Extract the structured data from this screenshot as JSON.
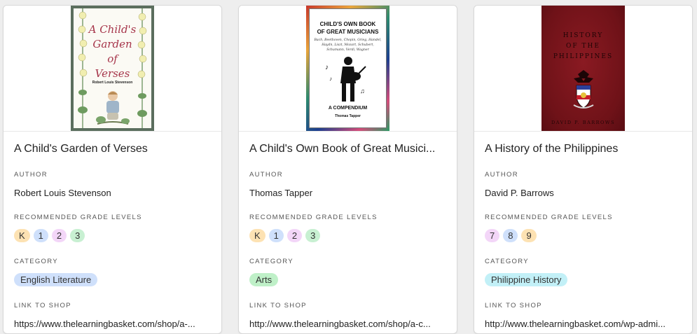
{
  "labels": {
    "author": "AUTHOR",
    "grades": "RECOMMENDED GRADE LEVELS",
    "category": "CATEGORY",
    "link": "LINK TO SHOP"
  },
  "colors": {
    "grade_K": "#fde2b3",
    "grade_1": "#cfe0fb",
    "grade_2": "#f3d6f8",
    "grade_3": "#c8f0d2",
    "grade_7": "#f3d6f8",
    "grade_8": "#cfe0fb",
    "grade_9": "#fde2b3",
    "cat_english": "#cfe0fb",
    "cat_arts": "#bff0c8",
    "cat_history": "#c2f0f7"
  },
  "books": [
    {
      "title": "A Child's Garden of Verses",
      "author": "Robert Louis Stevenson",
      "grades": [
        "K",
        "1",
        "2",
        "3"
      ],
      "category": "English Literature",
      "link": "https://www.thelearningbasket.com/shop/a-...",
      "cover": {
        "title_lines": [
          "A Child's",
          "Garden",
          "of",
          "Verses"
        ],
        "author": "Robert Louis Stevenson",
        "icon": "child-gardening-illustration-icon"
      }
    },
    {
      "title": "A Child's Own Book of Great Musici...",
      "author": "Thomas Tapper",
      "grades": [
        "K",
        "1",
        "2",
        "3"
      ],
      "category": "Arts",
      "link": "http://www.thelearningbasket.com/shop/a-c...",
      "cover": {
        "title_lines": [
          "CHILD'S OWN BOOK",
          "OF GREAT MUSICIANS"
        ],
        "subtitle": "Bach, Beethoven, Chopin, Grieg, Handel, Haydn, Liszt, Mozart, Schubert, Schumann, Verdi, Wagner",
        "compendium": "A COMPENDIUM",
        "author": "Thomas Tapper",
        "icon": "lute-player-silhouette-icon"
      }
    },
    {
      "title": "A History of the Philippines",
      "author": "David P. Barrows",
      "grades": [
        "7",
        "8",
        "9"
      ],
      "category": "Philippine History",
      "link": "http://www.thelearningbasket.com/wp-admi...",
      "cover": {
        "title_lines": [
          "HISTORY",
          "OF THE",
          "PHILIPPINES"
        ],
        "author": "DAVID P. BARROWS",
        "icon": "coat-of-arms-icon"
      }
    }
  ]
}
